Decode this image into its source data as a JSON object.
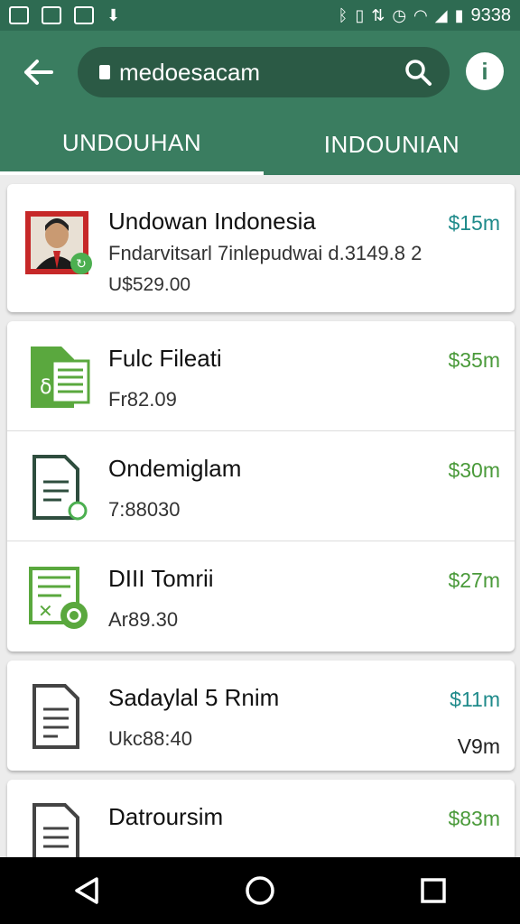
{
  "status": {
    "time": "9338"
  },
  "search": {
    "text": "medoesacam"
  },
  "tabs": [
    {
      "label": "UNDOUHAN",
      "active": true
    },
    {
      "label": "INDOUNIAN",
      "active": false
    }
  ],
  "items": [
    {
      "title": "Undowan Indonesia",
      "subtitle": "Fndarvitsarl 7inlepudwai d.3149.8 2",
      "subtitle2": "U$529.00",
      "price": "$15m",
      "icon": "profile-photo-icon"
    },
    {
      "title": "Fulc Fileati",
      "subtitle": "Fr82.09",
      "price": "$35m",
      "icon": "spreadsheet-file-icon"
    },
    {
      "title": "Ondemiglam",
      "subtitle": "7:88030",
      "price": "$30m",
      "icon": "document-file-icon"
    },
    {
      "title": "DIII Tomrii",
      "subtitle": "Ar89.30",
      "price": "$27m",
      "icon": "excel-file-icon"
    },
    {
      "title": "Sadaylal 5 Rnim",
      "subtitle": "Ukc88:40",
      "price": "$11m",
      "extra": "V9m",
      "icon": "text-file-icon"
    },
    {
      "title": "Datroursim",
      "subtitle": "",
      "price": "$83m",
      "icon": "text-file-icon"
    }
  ]
}
